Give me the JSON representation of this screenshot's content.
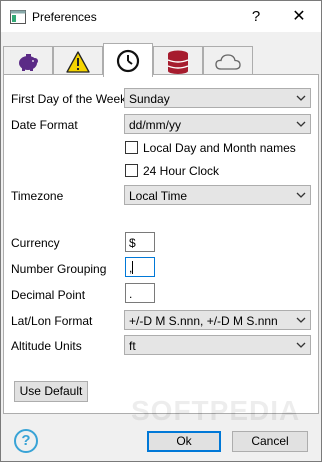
{
  "window": {
    "title": "Preferences",
    "help_glyph": "?",
    "close_glyph": "✕"
  },
  "tabs": [
    {
      "icon": "piggy-bank-icon",
      "active": false
    },
    {
      "icon": "warning-icon",
      "active": false
    },
    {
      "icon": "clock-icon",
      "active": true
    },
    {
      "icon": "database-icon",
      "active": false
    },
    {
      "icon": "cloud-icon",
      "active": false
    }
  ],
  "form": {
    "first_day_label": "First Day of the Week",
    "first_day_value": "Sunday",
    "date_format_label": "Date Format",
    "date_format_value": "dd/mm/yy",
    "local_names_label": "Local Day and Month names",
    "local_names_checked": false,
    "clock24_label": "24 Hour Clock",
    "clock24_checked": false,
    "timezone_label": "Timezone",
    "timezone_value": "Local Time",
    "currency_label": "Currency",
    "currency_value": "$",
    "number_grouping_label": "Number Grouping",
    "number_grouping_value": ",",
    "decimal_point_label": "Decimal Point",
    "decimal_point_value": ".",
    "latlon_label": "Lat/Lon Format",
    "latlon_value": "+/-D M S.nnn, +/-D M S.nnn",
    "altitude_label": "Altitude Units",
    "altitude_value": "ft",
    "use_default_label": "Use Default"
  },
  "footer": {
    "help_glyph": "?",
    "ok_label": "Ok",
    "cancel_label": "Cancel"
  },
  "watermark": "SOFTPEDIA",
  "colors": {
    "accent": "#0078d7",
    "help_blue": "#38a3d6",
    "piggy": "#5b2a86",
    "warning": "#f5d400",
    "database": "#a61c2e"
  }
}
